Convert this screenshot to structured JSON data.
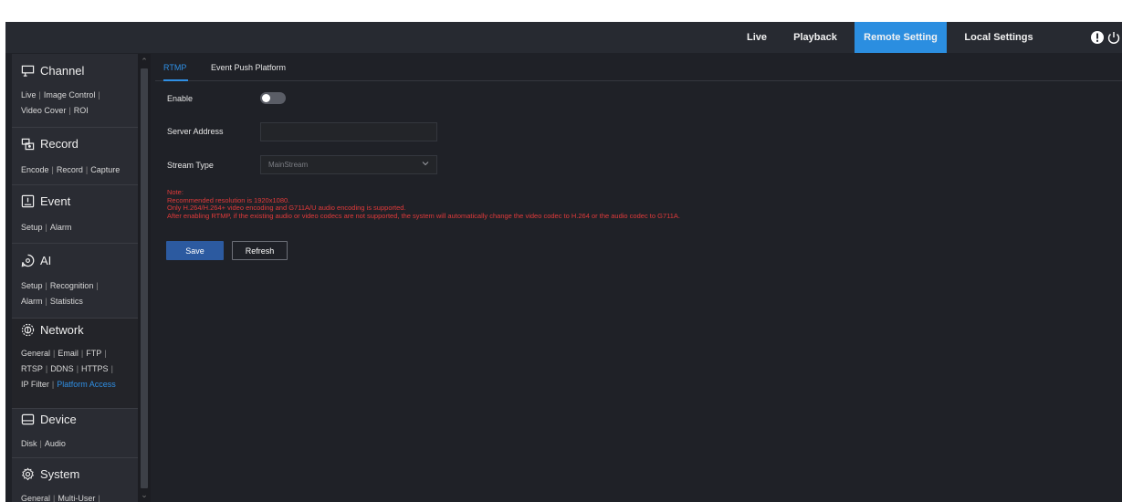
{
  "topnav": {
    "items": [
      {
        "label": "Live"
      },
      {
        "label": "Playback"
      },
      {
        "label": "Remote Setting"
      },
      {
        "label": "Local Settings"
      }
    ],
    "active_index": 2,
    "icons": [
      "alert-icon",
      "power-icon"
    ]
  },
  "sidebar": {
    "sections": [
      {
        "title": "Channel",
        "icon": "channel-icon",
        "rows": [
          [
            "Live",
            "Image Control"
          ],
          [
            "Video Cover",
            "ROI"
          ]
        ]
      },
      {
        "title": "Record",
        "icon": "record-icon",
        "rows": [
          [
            "Encode",
            "Record",
            "Capture"
          ]
        ]
      },
      {
        "title": "Event",
        "icon": "event-icon",
        "rows": [
          [
            "Setup",
            "Alarm"
          ]
        ]
      },
      {
        "title": "AI",
        "icon": "ai-icon",
        "rows": [
          [
            "Setup",
            "Recognition"
          ],
          [
            "Alarm",
            "Statistics"
          ]
        ]
      },
      {
        "title": "Network",
        "icon": "network-icon",
        "rows": [
          [
            "General",
            "Email",
            "FTP"
          ],
          [
            "RTSP",
            "DDNS",
            "HTTPS"
          ],
          [
            "IP Filter",
            "Platform Access"
          ]
        ]
      },
      {
        "title": "Device",
        "icon": "device-icon",
        "rows": [
          [
            "Disk",
            "Audio"
          ]
        ]
      },
      {
        "title": "System",
        "icon": "system-icon",
        "rows": [
          [
            "General",
            "Multi-User"
          ]
        ]
      }
    ],
    "active_section": "Network",
    "selected_link": "Platform Access"
  },
  "tabs": {
    "items": [
      {
        "label": "RTMP"
      },
      {
        "label": "Event Push Platform"
      }
    ],
    "active_index": 0
  },
  "form": {
    "enable_label": "Enable",
    "enable_value": false,
    "server_label": "Server Address",
    "server_value": "",
    "stream_label": "Stream Type",
    "stream_value": "MainStream"
  },
  "notes": [
    "Note:",
    "Recommended resolution is 1920x1080.",
    "Only H.264/H.264+ video encoding and G711A/U audio encoding is supported.",
    "After enabling RTMP, if the existing audio or video codecs are not supported, the system will automatically change the video codec to H.264 or the audio codec to G711A."
  ],
  "buttons": {
    "save": "Save",
    "refresh": "Refresh"
  },
  "colors": {
    "accent": "#2b8ee0",
    "note": "#e03a3a",
    "save_button": "#2c5aa0",
    "background": "#1f2127",
    "sidebar": "#2a2c33"
  }
}
